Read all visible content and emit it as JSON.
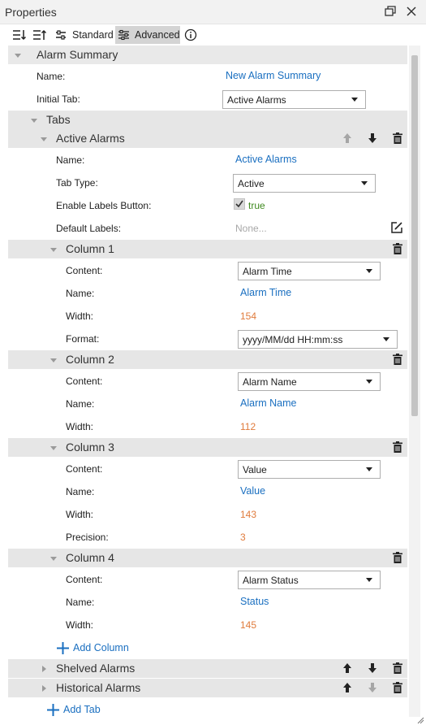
{
  "panel": {
    "title": "Properties"
  },
  "toolbar": {
    "standard_label": "Standard",
    "advanced_label": "Advanced"
  },
  "alarm_summary": {
    "label": "Alarm Summary",
    "name_label": "Name:",
    "name_value": "New Alarm Summary",
    "initial_tab_label": "Initial Tab:",
    "initial_tab_value": "Active Alarms"
  },
  "tabs": {
    "label": "Tabs",
    "active": {
      "label": "Active Alarms",
      "name_label": "Name:",
      "name_value": "Active Alarms",
      "tab_type_label": "Tab Type:",
      "tab_type_value": "Active",
      "enable_labels_label": "Enable Labels Button:",
      "enable_labels_value": "true",
      "default_labels_label": "Default Labels:",
      "default_labels_value": "None..."
    },
    "columns": [
      {
        "label": "Column 1",
        "content_label": "Content:",
        "content_value": "Alarm Time",
        "name_label": "Name:",
        "name_value": "Alarm Time",
        "width_label": "Width:",
        "width_value": "154",
        "format_label": "Format:",
        "format_value": "yyyy/MM/dd HH:mm:ss"
      },
      {
        "label": "Column 2",
        "content_label": "Content:",
        "content_value": "Alarm Name",
        "name_label": "Name:",
        "name_value": "Alarm Name",
        "width_label": "Width:",
        "width_value": "112"
      },
      {
        "label": "Column 3",
        "content_label": "Content:",
        "content_value": "Value",
        "name_label": "Name:",
        "name_value": "Value",
        "width_label": "Width:",
        "width_value": "143",
        "precision_label": "Precision:",
        "precision_value": "3"
      },
      {
        "label": "Column 4",
        "content_label": "Content:",
        "content_value": "Alarm Status",
        "name_label": "Name:",
        "name_value": "Status",
        "width_label": "Width:",
        "width_value": "145"
      }
    ],
    "add_column": "Add Column",
    "shelved_label": "Shelved Alarms",
    "historical_label": "Historical Alarms",
    "add_tab": "Add Tab"
  },
  "colors": {
    "link": "#1a6fc0",
    "number": "#e07b3c",
    "true": "#3f8a1f",
    "section": "#e6e6e6"
  },
  "icons": [
    "sort-ascending-icon",
    "sort-descending-icon",
    "sliders-icon",
    "info-icon",
    "maximize-icon",
    "close-icon",
    "arrow-up-icon",
    "arrow-down-icon",
    "trash-icon",
    "edit-icon",
    "plus-icon",
    "checkmark-icon"
  ]
}
